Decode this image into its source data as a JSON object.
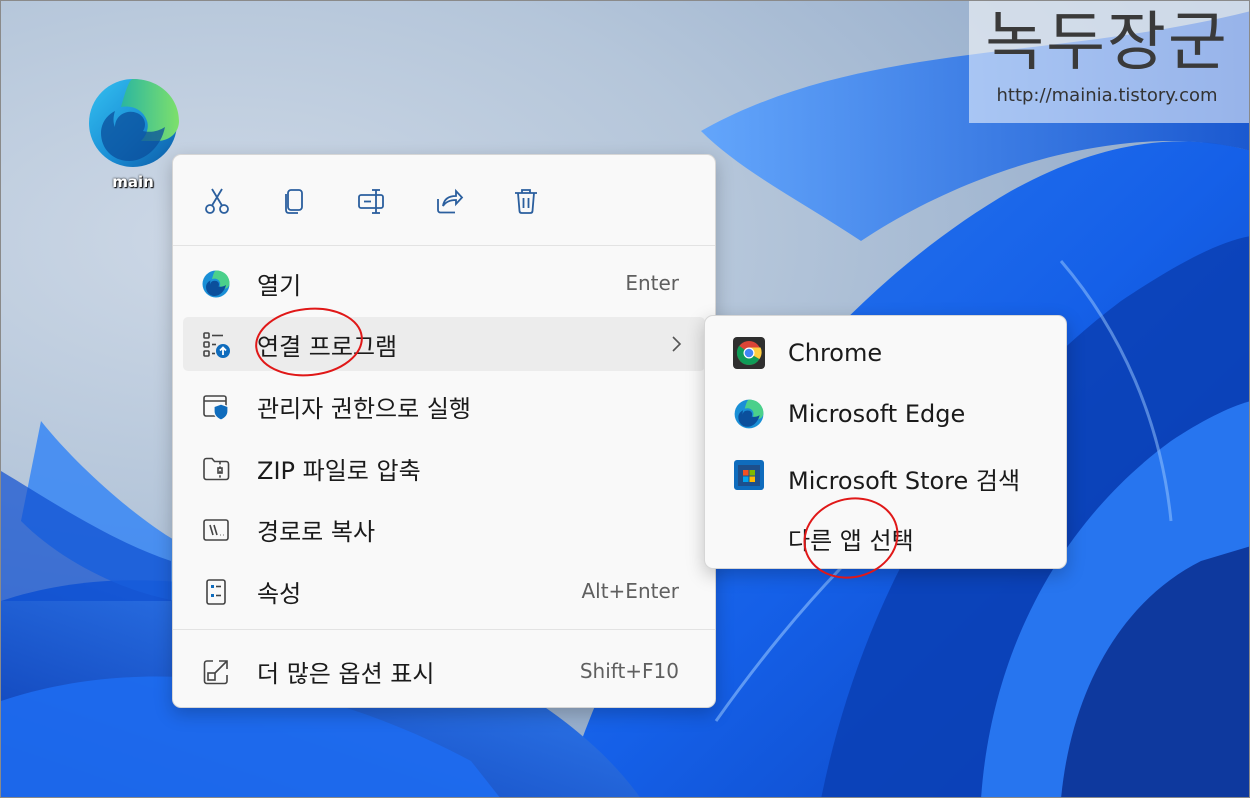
{
  "desktop": {
    "icon_label": "main",
    "icon": "edge-icon"
  },
  "watermark": {
    "title": "녹두장군",
    "url": "http://mainia.tistory.com"
  },
  "context_menu": {
    "toolbar": [
      {
        "name": "cut-icon",
        "tooltip": ""
      },
      {
        "name": "copy-icon",
        "tooltip": ""
      },
      {
        "name": "rename-icon",
        "tooltip": ""
      },
      {
        "name": "share-icon",
        "tooltip": ""
      },
      {
        "name": "delete-icon",
        "tooltip": ""
      }
    ],
    "items": [
      {
        "label": "열기",
        "shortcut": "Enter",
        "icon": "edge-icon"
      },
      {
        "label": "연결 프로그램",
        "shortcut": "",
        "icon": "open-with-icon",
        "has_submenu": true
      },
      {
        "label": "관리자 권한으로 실행",
        "shortcut": "",
        "icon": "admin-shield-icon"
      },
      {
        "label": "ZIP 파일로 압축",
        "shortcut": "",
        "icon": "zip-folder-icon"
      },
      {
        "label": "경로로 복사",
        "shortcut": "",
        "icon": "copy-path-icon"
      },
      {
        "label": "속성",
        "shortcut": "Alt+Enter",
        "icon": "properties-icon"
      },
      {
        "label": "더 많은 옵션 표시",
        "shortcut": "Shift+F10",
        "icon": "more-options-icon"
      }
    ]
  },
  "submenu": {
    "items": [
      {
        "label": "Chrome",
        "icon": "chrome-icon"
      },
      {
        "label": "Microsoft Edge",
        "icon": "edge-icon"
      },
      {
        "label": "Microsoft Store 검색",
        "icon": "store-icon"
      },
      {
        "label": "다른 앱 선택",
        "icon": ""
      }
    ]
  },
  "colors": {
    "annotation": "#e01818",
    "accent": "#0f6cbd",
    "menu_bg": "#f9f9f9"
  }
}
